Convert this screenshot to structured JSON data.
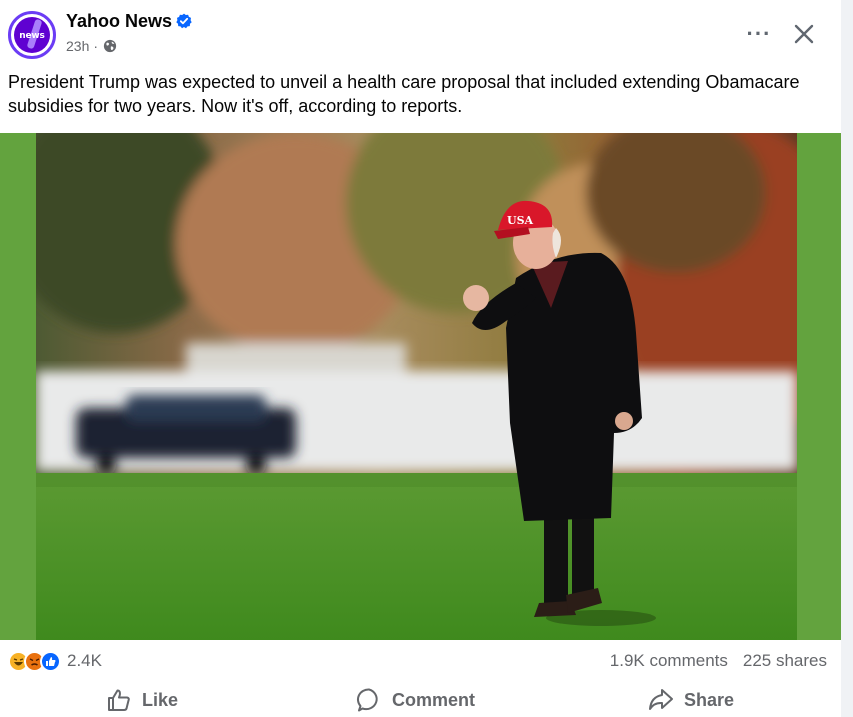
{
  "post": {
    "page_name": "Yahoo News",
    "avatar_text": "news",
    "timestamp": "23h",
    "separator": "·",
    "caption": "President Trump was expected to unveil a health care proposal that included extending Obamacare subsidies for two years. Now it's off, according to reports.",
    "photo_cap_text": "USA",
    "more_icon": "···"
  },
  "engagement": {
    "reaction_count": "2.4K",
    "comments": "1.9K comments",
    "shares": "225 shares",
    "reactions": [
      "haha",
      "angry",
      "like"
    ]
  },
  "actions": {
    "like_label": "Like",
    "comment_label": "Comment",
    "share_label": "Share"
  },
  "colors": {
    "brand_purple": "#5f01d1",
    "verified_blue": "#0866ff",
    "secondary_text": "#65676b",
    "photo_band_green": "#63a33e"
  },
  "icons": {
    "verified": "verified-badge-icon",
    "audience": "globe-icon",
    "more": "more-options-icon",
    "close": "close-icon",
    "like": "thumbs-up-icon",
    "comment": "comment-bubble-icon",
    "share": "share-arrow-icon"
  }
}
